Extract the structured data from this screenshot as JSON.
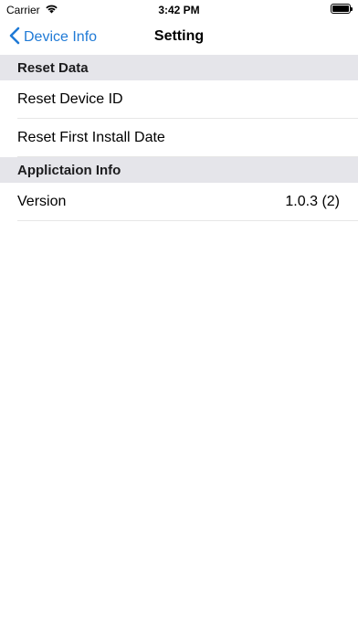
{
  "status_bar": {
    "carrier": "Carrier",
    "time": "3:42 PM"
  },
  "nav": {
    "back_label": "Device Info",
    "title": "Setting",
    "accent_color": "#1f7ad6"
  },
  "sections": [
    {
      "header": "Reset Data",
      "rows": [
        {
          "label": "Reset Device ID",
          "value": ""
        },
        {
          "label": "Reset First Install Date",
          "value": ""
        }
      ]
    },
    {
      "header": "Applictaion Info",
      "rows": [
        {
          "label": "Version",
          "value": "1.0.3 (2)"
        }
      ]
    }
  ],
  "icons": {
    "wifi": "wifi-icon",
    "battery": "battery-icon",
    "back": "chevron-left-icon"
  }
}
